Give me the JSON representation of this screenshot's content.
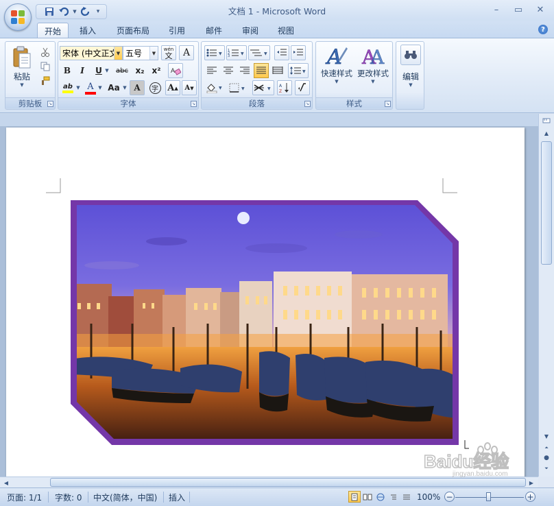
{
  "window": {
    "title": "文档 1 - Microsoft Word",
    "minimize": "–",
    "maximize": "▭",
    "close": "✕"
  },
  "tabs": [
    {
      "label": "开始",
      "active": true
    },
    {
      "label": "插入"
    },
    {
      "label": "页面布局"
    },
    {
      "label": "引用"
    },
    {
      "label": "邮件"
    },
    {
      "label": "审阅"
    },
    {
      "label": "视图"
    }
  ],
  "ribbon": {
    "clipboard": {
      "label": "剪贴板",
      "paste": "粘贴"
    },
    "font": {
      "label": "字体",
      "font_name": "宋体 (中文正文)",
      "font_size": "五号",
      "wen": "wén\n文",
      "border_a": "A",
      "bold": "B",
      "italic": "I",
      "underline": "U",
      "strike": "abc",
      "subscript": "x₂",
      "superscript": "x²",
      "highlight": "ab",
      "font_color": "A",
      "case": "Aa",
      "shade_a": "A",
      "enclose": "字",
      "grow": "A",
      "shrink": "A"
    },
    "paragraph": {
      "label": "段落"
    },
    "styles": {
      "label": "样式",
      "quick_styles": "快速样式",
      "change_styles": "更改样式"
    },
    "editing": {
      "label": "编辑"
    }
  },
  "status": {
    "page": "页面: 1/1",
    "words": "字数: 0",
    "language": "中文(简体，中国)",
    "mode": "插入",
    "zoom": "100%",
    "zoom_value": 100
  },
  "watermark": {
    "text": "Baidu经验",
    "sub": "jingyan.baidu.com"
  },
  "colors": {
    "frame": "#7437a8",
    "ribbon_bg": "#dbe6f4",
    "accent": "#ffc94d"
  }
}
